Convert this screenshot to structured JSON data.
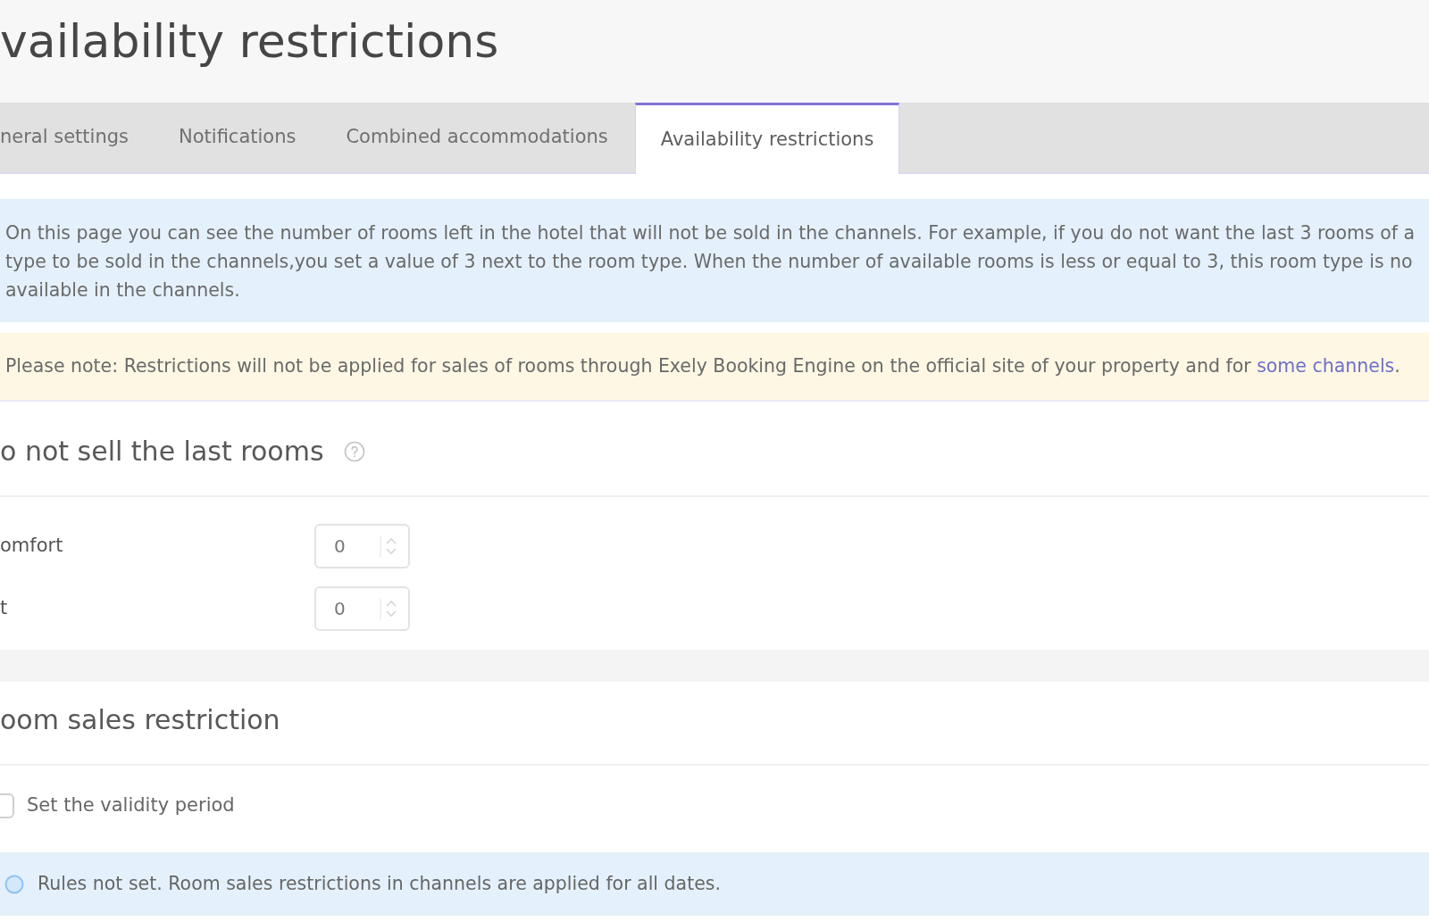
{
  "page": {
    "title": "vailability restrictions"
  },
  "tabs": [
    {
      "label": "neral settings",
      "selected": false
    },
    {
      "label": "Notifications",
      "selected": false
    },
    {
      "label": "Combined accommodations",
      "selected": false
    },
    {
      "label": "Availability restrictions",
      "selected": true
    }
  ],
  "info": {
    "lines": [
      "On this page you can see the number of rooms left in the hotel that will not be sold in the channels. For example, if you do not want the last 3 rooms of a",
      "type to be sold in the channels,you set a value of 3 next to the room type. When the number of available rooms is less or equal to 3, this room type is no",
      "available in the channels."
    ]
  },
  "note": {
    "parts": [
      {
        "kind": "text",
        "text": "Please note: Restrictions will not be applied for sales of rooms through Exely Booking Engine on the official site of your property and for "
      },
      {
        "kind": "link",
        "text": "some channels"
      },
      {
        "kind": "text",
        "text": "."
      }
    ]
  },
  "sections": [
    {
      "kind": "room_limits",
      "title": "o not sell the last rooms",
      "rows": [
        {
          "label": "omfort",
          "value": "0"
        },
        {
          "label": "t",
          "value": "0"
        }
      ]
    },
    {
      "kind": "sales_restriction",
      "title": "oom sales restriction",
      "checkbox": {
        "label": "Set the validity period",
        "checked": false
      },
      "message": "Rules not set. Room sales restrictions in channels are applied for all dates."
    }
  ]
}
